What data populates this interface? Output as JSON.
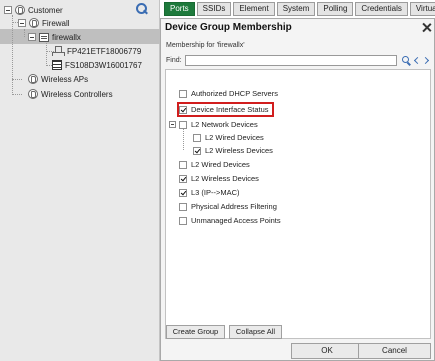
{
  "tree": {
    "nodes": [
      {
        "label": "Customer"
      },
      {
        "label": "Firewall"
      },
      {
        "label": "firewallx"
      },
      {
        "label": "FP421ETF18006779"
      },
      {
        "label": "FS108D3W16001767"
      },
      {
        "label": "Wireless APs"
      },
      {
        "label": "Wireless Controllers"
      }
    ],
    "search_icon": "search-icon"
  },
  "tabs": [
    "Ports",
    "SSIDs",
    "Element",
    "System",
    "Polling",
    "Credentials",
    "Virtua"
  ],
  "active_tab": "Ports",
  "dialog": {
    "title": "Device Group Membership",
    "membership_label": "Membership for 'firewallx'",
    "find_label": "Find:",
    "find_value": "",
    "groups": [
      {
        "label": "Authorized DHCP Servers",
        "checked": false
      },
      {
        "label": "Device Interface Status",
        "checked": true
      },
      {
        "label": "L2 Network Devices",
        "checked": false
      },
      {
        "label": "L2 Wired Devices",
        "checked": false
      },
      {
        "label": "L2 Wireless Devices",
        "checked": true
      },
      {
        "label": "L2 Wired Devices",
        "checked": false
      },
      {
        "label": "L2 Wireless Devices",
        "checked": true
      },
      {
        "label": "L3 (IP-->MAC)",
        "checked": true
      },
      {
        "label": "Physical Address Filtering",
        "checked": false
      },
      {
        "label": "Unmanaged Access Points",
        "checked": false
      }
    ],
    "buttons": {
      "create_group": "Create Group",
      "collapse_all": "Collapse All",
      "ok": "OK",
      "cancel": "Cancel"
    }
  },
  "colors": {
    "active_tab": "#1e7a3c",
    "highlight": "#d11d1d",
    "link_blue": "#3b6db3"
  }
}
